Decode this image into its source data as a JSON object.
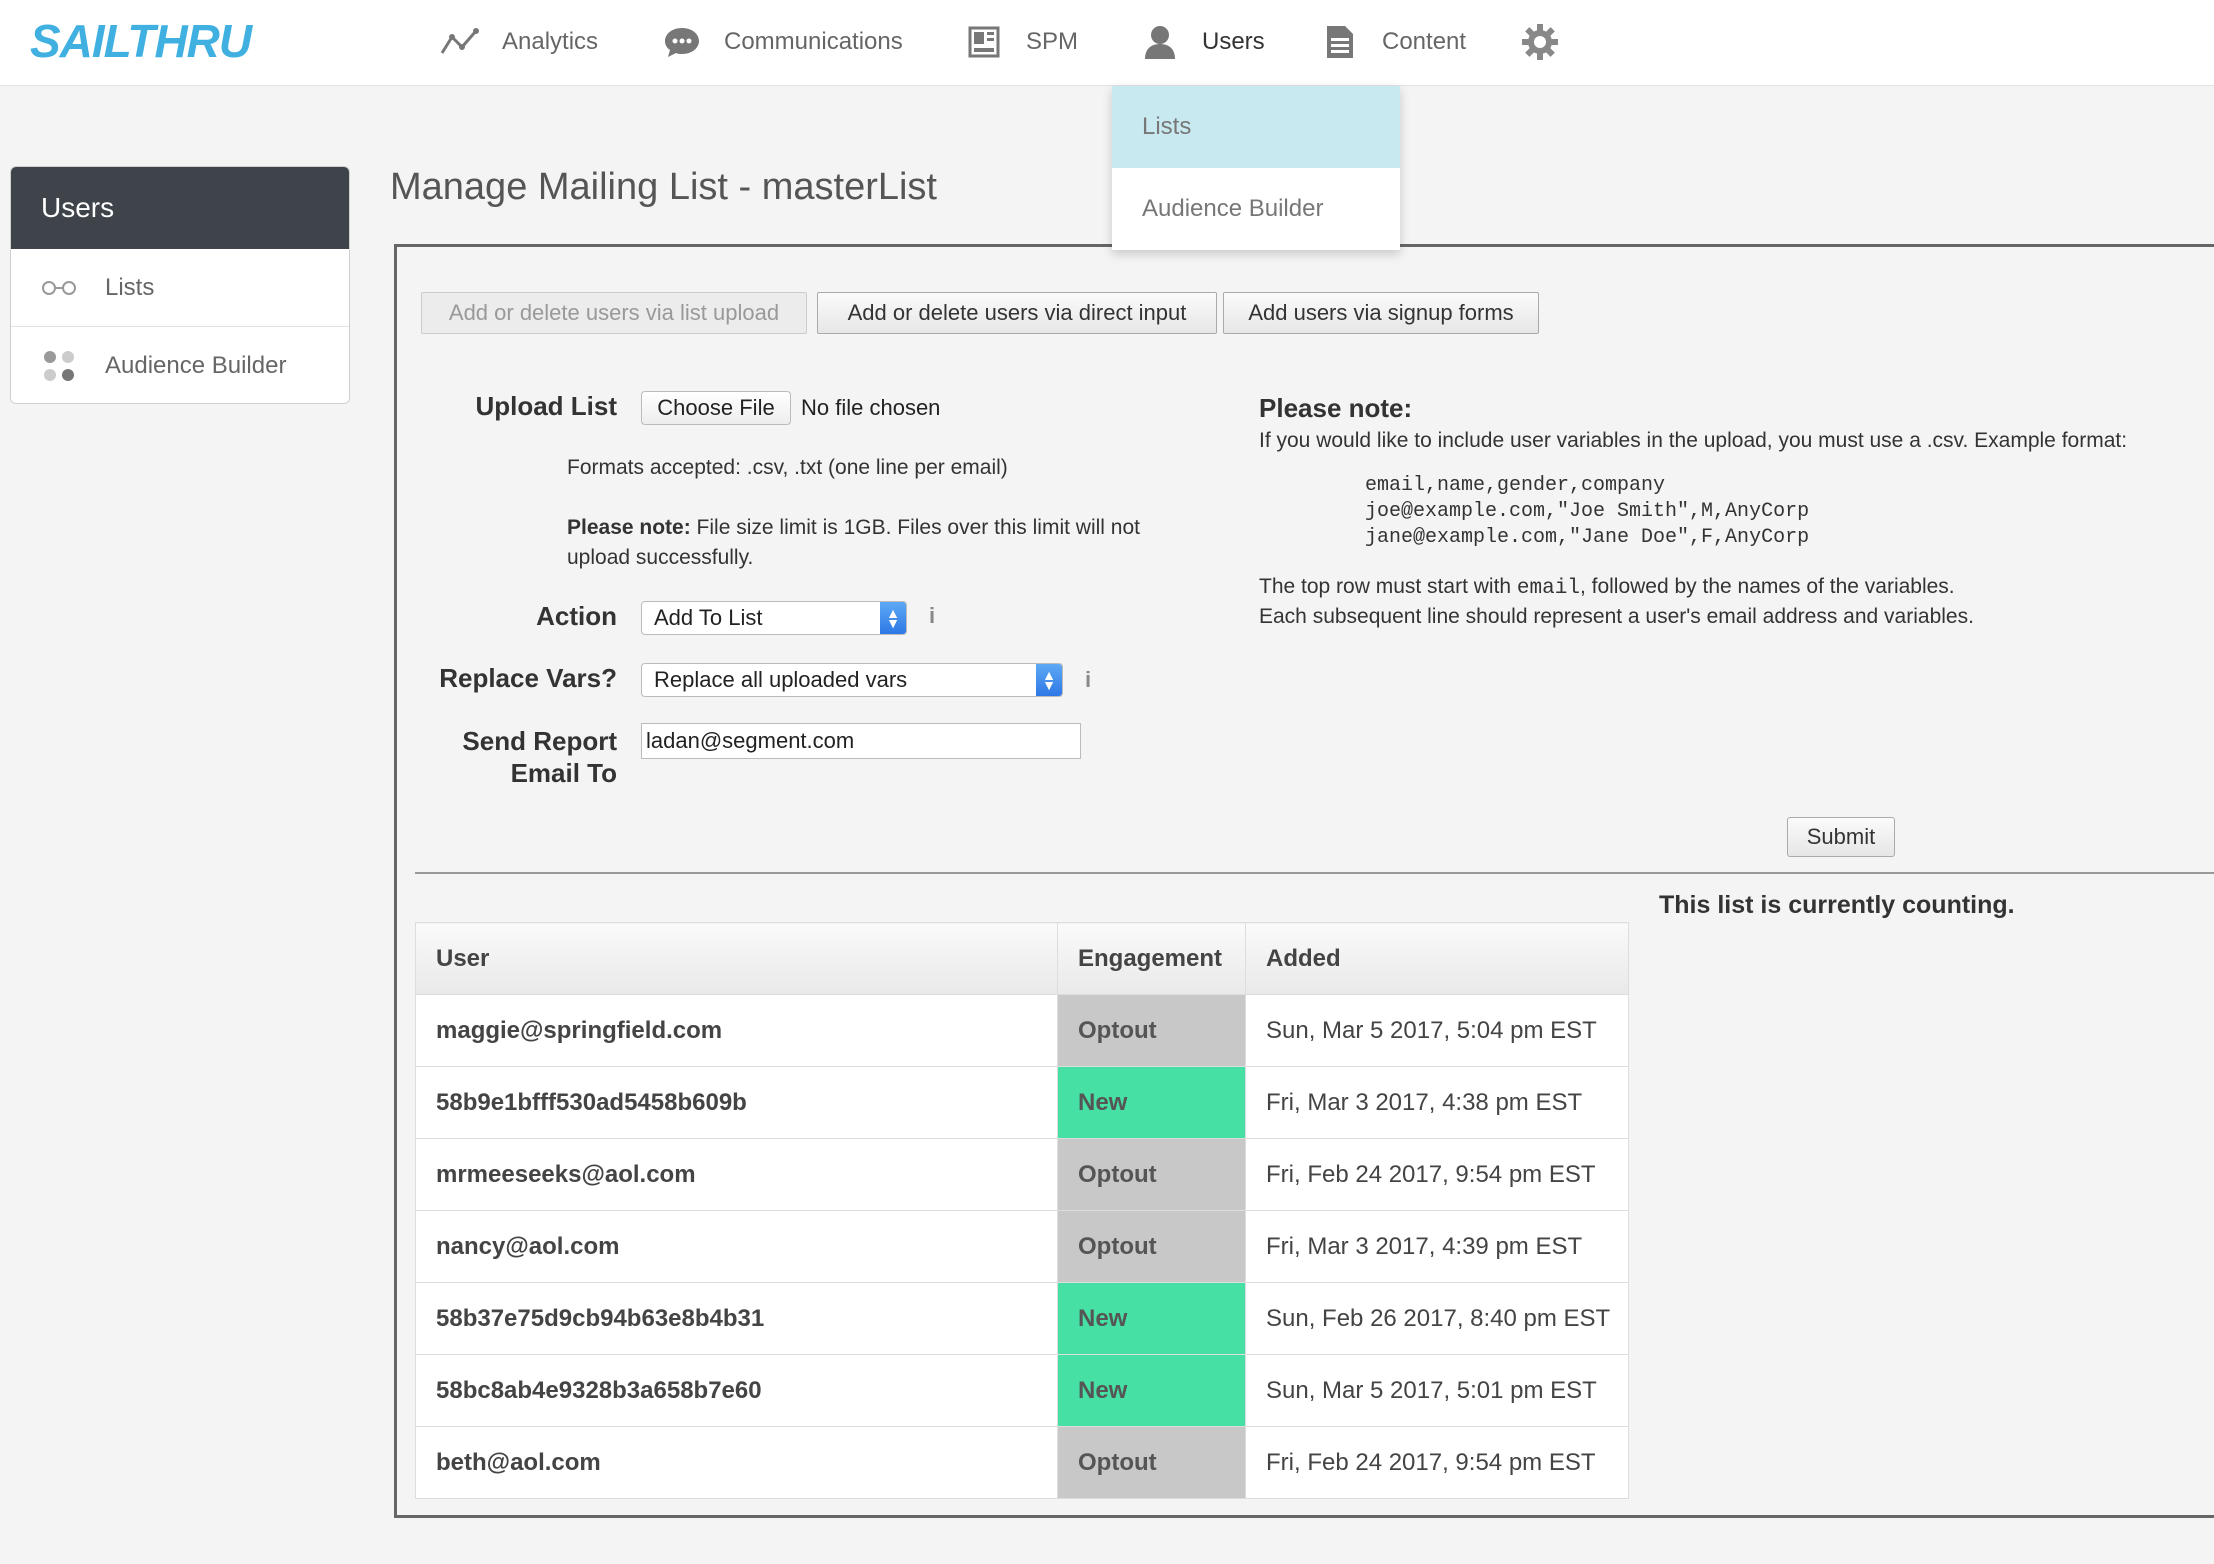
{
  "app": {
    "logo": "SAILTHRU"
  },
  "nav": {
    "items": [
      {
        "label": "Analytics",
        "icon": "analytics-icon"
      },
      {
        "label": "Communications",
        "icon": "chat-bubble-icon"
      },
      {
        "label": "SPM",
        "icon": "layout-icon"
      },
      {
        "label": "Users",
        "icon": "user-icon"
      },
      {
        "label": "Content",
        "icon": "document-icon"
      }
    ],
    "settings_icon": "gear-icon",
    "dropdown": [
      {
        "label": "Lists",
        "active": true
      },
      {
        "label": "Audience Builder",
        "active": false
      }
    ]
  },
  "sidebar": {
    "title": "Users",
    "items": [
      {
        "label": "Lists",
        "icon": "glasses-icon"
      },
      {
        "label": "Audience Builder",
        "icon": "dots-icon"
      }
    ]
  },
  "page": {
    "title": "Manage Mailing List - masterList"
  },
  "tabs": [
    {
      "label": "Add or delete users via list upload",
      "disabled": true
    },
    {
      "label": "Add or delete users via direct input",
      "disabled": false
    },
    {
      "label": "Add users via signup forms",
      "disabled": false
    }
  ],
  "form": {
    "upload_label": "Upload List",
    "choose_file": "Choose File",
    "no_file": "No file chosen",
    "formats": "Formats accepted: .csv, .txt (one line per email)",
    "size_note_bold": "Please note:",
    "size_note_line1": " File size limit is 1GB. Files over this limit will not",
    "size_note_line2": "upload successfully.",
    "action_label": "Action",
    "action_value": "Add To List",
    "replace_label": "Replace Vars?",
    "replace_value": "Replace all uploaded vars",
    "report_label_1": "Send Report",
    "report_label_2": "Email To",
    "report_email": "ladan@segment.com",
    "info_glyph": "i",
    "submit": "Submit"
  },
  "note": {
    "title": "Please note:",
    "line1": "If you would like to include user variables in the upload, you must use a .csv. Example format:",
    "code": "email,name,gender,company\njoe@example.com,\"Joe Smith\",M,AnyCorp\njane@example.com,\"Jane Doe\",F,AnyCorp",
    "line2_pre": "The top row must start with ",
    "line2_code": "email",
    "line2_post": ", followed by the names of the variables.",
    "line3": "Each subsequent line should represent a user's email address and variables."
  },
  "counting": "This list is currently counting.",
  "table": {
    "headers": [
      "User",
      "Engagement",
      "Added"
    ],
    "rows": [
      {
        "user": "maggie@springfield.com",
        "engagement": "Optout",
        "added": "Sun, Mar 5 2017, 5:04 pm EST"
      },
      {
        "user": "58b9e1bfff530ad5458b609b",
        "engagement": "New",
        "added": "Fri, Mar 3 2017, 4:38 pm EST"
      },
      {
        "user": "mrmeeseeks@aol.com",
        "engagement": "Optout",
        "added": "Fri, Feb 24 2017, 9:54 pm EST"
      },
      {
        "user": "nancy@aol.com",
        "engagement": "Optout",
        "added": "Fri, Mar 3 2017, 4:39 pm EST"
      },
      {
        "user": "58b37e75d9cb94b63e8b4b31",
        "engagement": "New",
        "added": "Sun, Feb 26 2017, 8:40 pm EST"
      },
      {
        "user": "58bc8ab4e9328b3a658b7e60",
        "engagement": "New",
        "added": "Sun, Mar 5 2017, 5:01 pm EST"
      },
      {
        "user": "beth@aol.com",
        "engagement": "Optout",
        "added": "Fri, Feb 24 2017, 9:54 pm EST"
      }
    ]
  },
  "colors": {
    "brand": "#3fb0e0",
    "new": "#46e0a4",
    "optout": "#c8c8c8",
    "dropdown_active": "#c8e9f0"
  }
}
